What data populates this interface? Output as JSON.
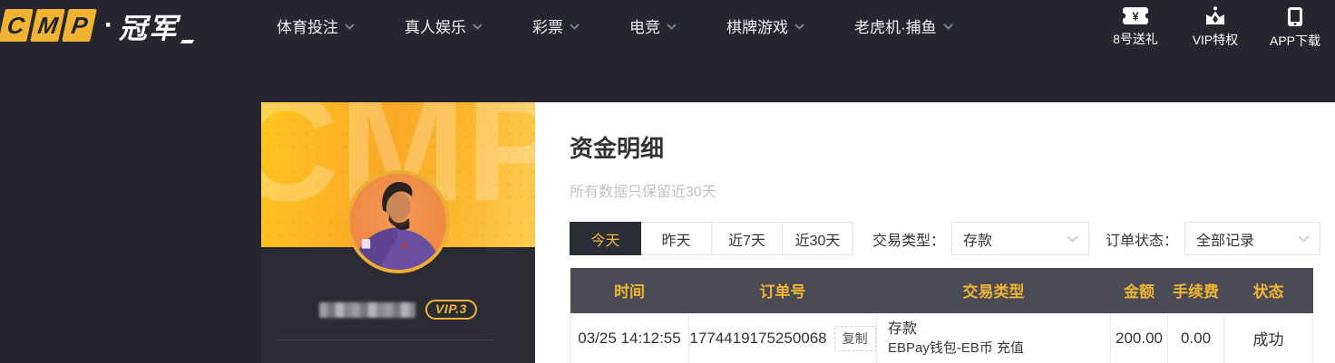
{
  "colors": {
    "accent_yellow": "#f0b332",
    "dark_bg": "#26272e",
    "tab_active_bg": "#2b2d35",
    "tab_active_text": "#f6b93c",
    "table_header_bg": "#4a4b54",
    "table_header_text": "#f0b332",
    "status_success_green": "#3ca04a",
    "sidebar_yellow": "#faa927"
  },
  "topnav": {
    "logo": {
      "block1": "C",
      "block2": "M",
      "block3": "P",
      "dot": "·",
      "brand": "冠军"
    },
    "menu": [
      {
        "label": "体育投注"
      },
      {
        "label": "真人娱乐"
      },
      {
        "label": "彩票"
      },
      {
        "label": "电竞"
      },
      {
        "label": "棋牌游戏"
      },
      {
        "label": "老虎机·捕鱼"
      }
    ],
    "quick_links": [
      {
        "icon": "gift-voucher-icon",
        "label": "8号送礼"
      },
      {
        "icon": "crown-icon",
        "label": "VIP特权"
      },
      {
        "icon": "phone-icon",
        "label": "APP下载"
      }
    ]
  },
  "sidebar": {
    "watermark": "CMP",
    "vip_badge": "VIP.3"
  },
  "main": {
    "title": "资金明细",
    "subtitle": "所有数据只保留近30天",
    "date_tabs": [
      {
        "label": "今天",
        "active": true
      },
      {
        "label": "昨天",
        "active": false
      },
      {
        "label": "近7天",
        "active": false
      },
      {
        "label": "近30天",
        "active": false
      }
    ],
    "filters": {
      "type_label": "交易类型：",
      "type_value": "存款",
      "status_label": "订单状态：",
      "status_value": "全部记录"
    },
    "table": {
      "columns": [
        "时间",
        "订单号",
        "交易类型",
        "金额",
        "手续费",
        "状态"
      ],
      "rows": [
        {
          "time": "03/25 14:12:55",
          "order_no": "1774419175250068",
          "copy_label": "复制",
          "type_line1": "存款",
          "type_line2": "EBPay钱包-EB币 充值",
          "amount": "200.00",
          "fee": "0.00",
          "status": "成功"
        }
      ]
    }
  }
}
